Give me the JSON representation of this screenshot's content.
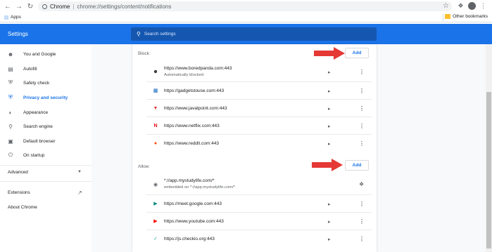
{
  "browser": {
    "site_name": "Chrome",
    "url": "chrome://settings/content/notifications",
    "bookmarks": {
      "apps_label": "Apps",
      "other_label": "Other bookmarks"
    }
  },
  "header": {
    "title": "Settings",
    "search_placeholder": "Search settings"
  },
  "sidebar": {
    "items": [
      {
        "label": "You and Google",
        "icon": "person-icon"
      },
      {
        "label": "Autofill",
        "icon": "clipboard-icon"
      },
      {
        "label": "Safety check",
        "icon": "shield-check-icon"
      },
      {
        "label": "Privacy and security",
        "icon": "shield-icon",
        "active": true
      },
      {
        "label": "Appearance",
        "icon": "palette-icon"
      },
      {
        "label": "Search engine",
        "icon": "search-icon"
      },
      {
        "label": "Default browser",
        "icon": "browser-icon"
      },
      {
        "label": "On startup",
        "icon": "power-icon"
      }
    ],
    "advanced_label": "Advanced",
    "extensions_label": "Extensions",
    "about_label": "About Chrome"
  },
  "block": {
    "title": "Block",
    "add_label": "Add",
    "sites": [
      {
        "url": "https://www.boredpanda.com:443",
        "sub": "Automatically blocked",
        "icon": "panda-icon"
      },
      {
        "url": "https://gadgetstouse.com:443",
        "icon": "gadgets-icon"
      },
      {
        "url": "https://www.javatpoint.com:443",
        "icon": "javatpoint-icon"
      },
      {
        "url": "https://www.netflix.com:443",
        "icon": "netflix-icon"
      },
      {
        "url": "https://www.reddit.com:443",
        "icon": "reddit-icon"
      }
    ]
  },
  "allow": {
    "title": "Allow",
    "add_label": "Add",
    "sites": [
      {
        "url": "*://app.mystudylife.com/*",
        "sub": "embedded on *://app.mystudylife.com/*",
        "icon": "globe-icon",
        "extension": true
      },
      {
        "url": "https://meet.google.com:443",
        "icon": "meet-icon"
      },
      {
        "url": "https://www.youtube.com:443",
        "icon": "youtube-icon"
      },
      {
        "url": "https://js.checkio.org:443",
        "icon": "checkio-icon"
      }
    ]
  },
  "colors": {
    "accent": "#1a73e8",
    "arrow": "#e53935"
  }
}
